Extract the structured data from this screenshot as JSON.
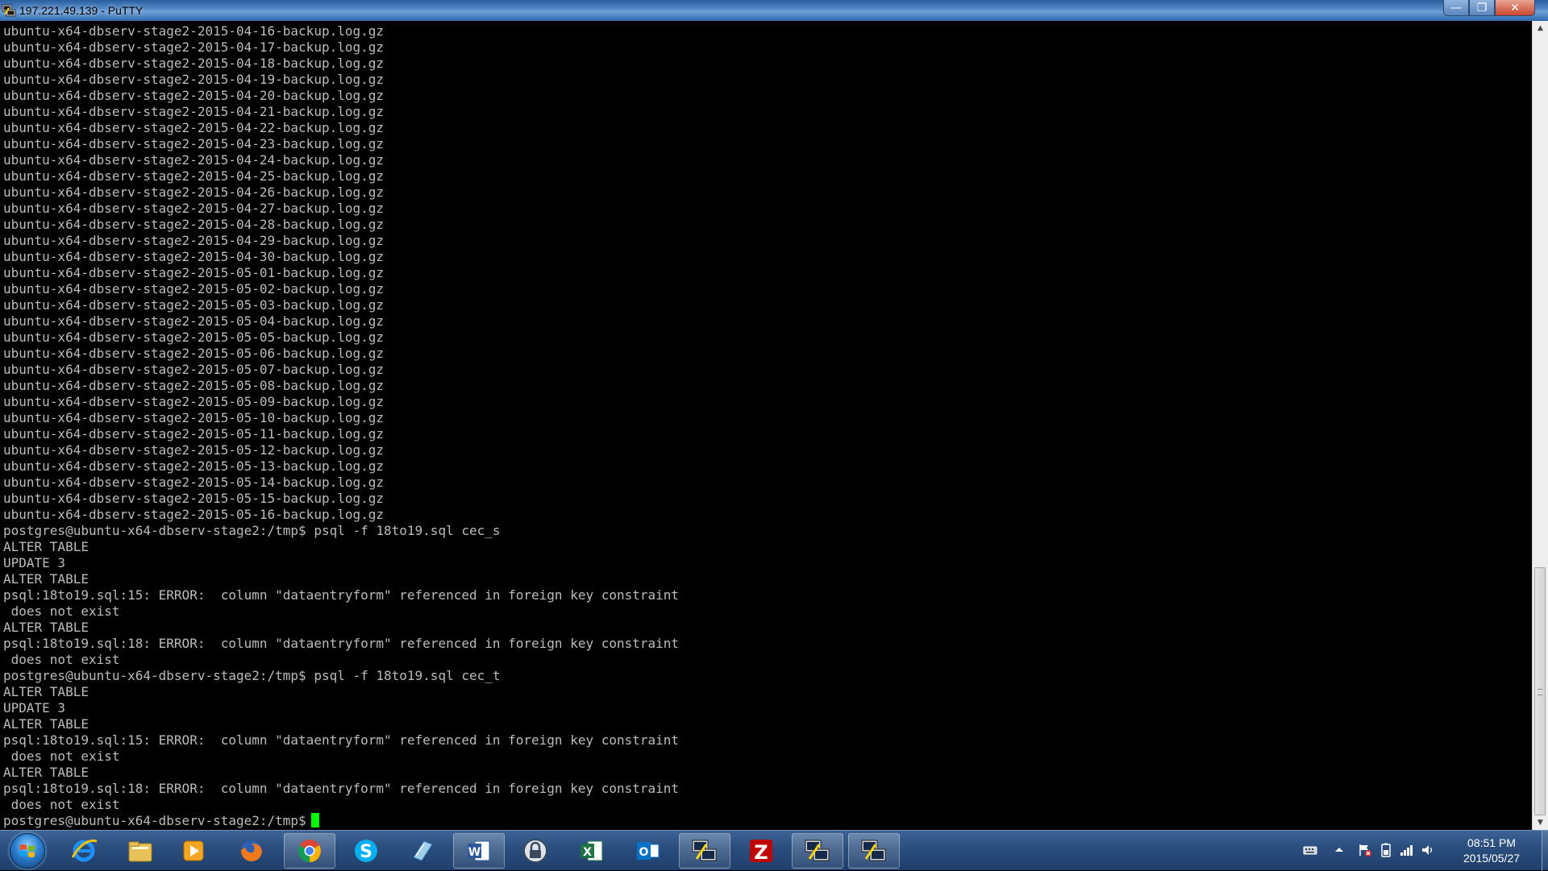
{
  "window": {
    "title": "197.221.49.139 - PuTTY",
    "min_label": "—",
    "max_label": "❐",
    "close_label": "✕"
  },
  "terminal": {
    "lines": [
      "ubuntu-x64-dbserv-stage2-2015-04-16-backup.log.gz",
      "ubuntu-x64-dbserv-stage2-2015-04-17-backup.log.gz",
      "ubuntu-x64-dbserv-stage2-2015-04-18-backup.log.gz",
      "ubuntu-x64-dbserv-stage2-2015-04-19-backup.log.gz",
      "ubuntu-x64-dbserv-stage2-2015-04-20-backup.log.gz",
      "ubuntu-x64-dbserv-stage2-2015-04-21-backup.log.gz",
      "ubuntu-x64-dbserv-stage2-2015-04-22-backup.log.gz",
      "ubuntu-x64-dbserv-stage2-2015-04-23-backup.log.gz",
      "ubuntu-x64-dbserv-stage2-2015-04-24-backup.log.gz",
      "ubuntu-x64-dbserv-stage2-2015-04-25-backup.log.gz",
      "ubuntu-x64-dbserv-stage2-2015-04-26-backup.log.gz",
      "ubuntu-x64-dbserv-stage2-2015-04-27-backup.log.gz",
      "ubuntu-x64-dbserv-stage2-2015-04-28-backup.log.gz",
      "ubuntu-x64-dbserv-stage2-2015-04-29-backup.log.gz",
      "ubuntu-x64-dbserv-stage2-2015-04-30-backup.log.gz",
      "ubuntu-x64-dbserv-stage2-2015-05-01-backup.log.gz",
      "ubuntu-x64-dbserv-stage2-2015-05-02-backup.log.gz",
      "ubuntu-x64-dbserv-stage2-2015-05-03-backup.log.gz",
      "ubuntu-x64-dbserv-stage2-2015-05-04-backup.log.gz",
      "ubuntu-x64-dbserv-stage2-2015-05-05-backup.log.gz",
      "ubuntu-x64-dbserv-stage2-2015-05-06-backup.log.gz",
      "ubuntu-x64-dbserv-stage2-2015-05-07-backup.log.gz",
      "ubuntu-x64-dbserv-stage2-2015-05-08-backup.log.gz",
      "ubuntu-x64-dbserv-stage2-2015-05-09-backup.log.gz",
      "ubuntu-x64-dbserv-stage2-2015-05-10-backup.log.gz",
      "ubuntu-x64-dbserv-stage2-2015-05-11-backup.log.gz",
      "ubuntu-x64-dbserv-stage2-2015-05-12-backup.log.gz",
      "ubuntu-x64-dbserv-stage2-2015-05-13-backup.log.gz",
      "ubuntu-x64-dbserv-stage2-2015-05-14-backup.log.gz",
      "ubuntu-x64-dbserv-stage2-2015-05-15-backup.log.gz",
      "ubuntu-x64-dbserv-stage2-2015-05-16-backup.log.gz",
      "postgres@ubuntu-x64-dbserv-stage2:/tmp$ psql -f 18to19.sql cec_s",
      "ALTER TABLE",
      "UPDATE 3",
      "ALTER TABLE",
      "psql:18to19.sql:15: ERROR:  column \"dataentryform\" referenced in foreign key constraint",
      " does not exist",
      "ALTER TABLE",
      "psql:18to19.sql:18: ERROR:  column \"dataentryform\" referenced in foreign key constraint",
      " does not exist",
      "postgres@ubuntu-x64-dbserv-stage2:/tmp$ psql -f 18to19.sql cec_t",
      "ALTER TABLE",
      "UPDATE 3",
      "ALTER TABLE",
      "psql:18to19.sql:15: ERROR:  column \"dataentryform\" referenced in foreign key constraint",
      " does not exist",
      "ALTER TABLE",
      "psql:18to19.sql:18: ERROR:  column \"dataentryform\" referenced in foreign key constraint",
      " does not exist"
    ],
    "prompt": "postgres@ubuntu-x64-dbserv-stage2:/tmp$",
    "text_color": "#bbbbbb",
    "cursor_color": "#00ff00",
    "background": "#000000"
  },
  "scrollbar": {
    "position_fraction": 1.0
  },
  "taskbar": {
    "apps": [
      {
        "name": "internet-explorer",
        "icon": "ie-icon"
      },
      {
        "name": "file-explorer",
        "icon": "folder-icon"
      },
      {
        "name": "media-player",
        "icon": "media-player-icon"
      },
      {
        "name": "firefox",
        "icon": "firefox-icon"
      },
      {
        "name": "chrome",
        "icon": "chrome-icon"
      },
      {
        "name": "skype",
        "icon": "skype-icon"
      },
      {
        "name": "notepad",
        "icon": "notepad-icon"
      },
      {
        "name": "word",
        "icon": "word-icon"
      },
      {
        "name": "keepass",
        "icon": "lock-icon"
      },
      {
        "name": "excel",
        "icon": "excel-icon"
      },
      {
        "name": "outlook",
        "icon": "outlook-icon"
      },
      {
        "name": "putty-1",
        "icon": "putty-icon"
      },
      {
        "name": "filezilla",
        "icon": "filezilla-icon"
      },
      {
        "name": "putty-2",
        "icon": "putty-icon"
      },
      {
        "name": "putty-3",
        "icon": "putty-icon"
      }
    ],
    "clock": {
      "time": "08:51 PM",
      "date": "2015/05/27"
    }
  }
}
